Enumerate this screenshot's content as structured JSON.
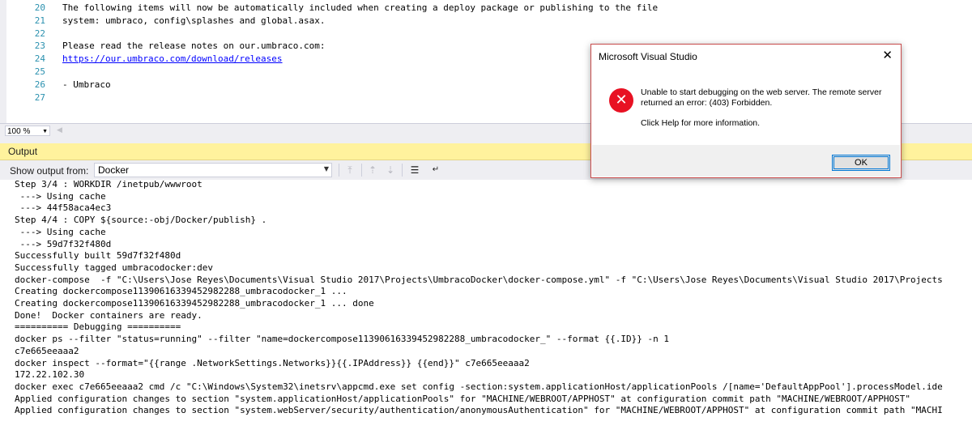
{
  "editor": {
    "lines": [
      {
        "no": "20",
        "text": "The following items will now be automatically included when creating a deploy package or publishing to the file",
        "link": false
      },
      {
        "no": "21",
        "text": "system: umbraco, config\\splashes and global.asax.",
        "link": false
      },
      {
        "no": "22",
        "text": "",
        "link": false
      },
      {
        "no": "23",
        "text": "Please read the release notes on our.umbraco.com:",
        "link": false
      },
      {
        "no": "24",
        "text": "https://our.umbraco.com/download/releases",
        "link": true
      },
      {
        "no": "25",
        "text": "",
        "link": false
      },
      {
        "no": "26",
        "text": "- Umbraco",
        "link": false
      },
      {
        "no": "27",
        "text": "",
        "link": false
      }
    ],
    "zoom": "100 %"
  },
  "output": {
    "title": "Output",
    "show_from_label": "Show output from:",
    "source": "Docker",
    "lines": [
      "Step 3/4 : WORKDIR /inetpub/wwwroot",
      " ---> Using cache",
      " ---> 44f58aca4ec3",
      "Step 4/4 : COPY ${source:-obj/Docker/publish} .",
      " ---> Using cache",
      " ---> 59d7f32f480d",
      "Successfully built 59d7f32f480d",
      "Successfully tagged umbracodocker:dev",
      "docker-compose  -f \"C:\\Users\\Jose Reyes\\Documents\\Visual Studio 2017\\Projects\\UmbracoDocker\\docker-compose.yml\" -f \"C:\\Users\\Jose Reyes\\Documents\\Visual Studio 2017\\Projects",
      "Creating dockercompose11390616339452982288_umbracodocker_1 ...",
      "Creating dockercompose11390616339452982288_umbracodocker_1 ... done",
      "Done!  Docker containers are ready.",
      "========== Debugging ==========",
      "docker ps --filter \"status=running\" --filter \"name=dockercompose11390616339452982288_umbracodocker_\" --format {{.ID}} -n 1",
      "c7e665eeaaa2",
      "docker inspect --format=\"{{range .NetworkSettings.Networks}}{{.IPAddress}} {{end}}\" c7e665eeaaa2",
      "172.22.102.30",
      "docker exec c7e665eeaaa2 cmd /c \"C:\\Windows\\System32\\inetsrv\\appcmd.exe set config -section:system.applicationHost/applicationPools /[name='DefaultAppPool'].processModel.ide",
      "Applied configuration changes to section \"system.applicationHost/applicationPools\" for \"MACHINE/WEBROOT/APPHOST\" at configuration commit path \"MACHINE/WEBROOT/APPHOST\"",
      "Applied configuration changes to section \"system.webServer/security/authentication/anonymousAuthentication\" for \"MACHINE/WEBROOT/APPHOST\" at configuration commit path \"MACHI"
    ]
  },
  "dialog": {
    "title": "Microsoft Visual Studio",
    "message": "Unable to start debugging on the web server. The remote server returned an error: (403) Forbidden.",
    "help": "Click Help for more information.",
    "ok_label": "OK"
  },
  "icons": {
    "close": "close-icon",
    "error": "error-icon",
    "dropdown": "chevron-down-icon"
  },
  "colors": {
    "output_header": "#fff29d",
    "line_numbers": "#2b91af",
    "link": "#0000ff",
    "error_icon": "#e81123",
    "dialog_border": "#c84c4c",
    "ok_border": "#0078d7"
  }
}
